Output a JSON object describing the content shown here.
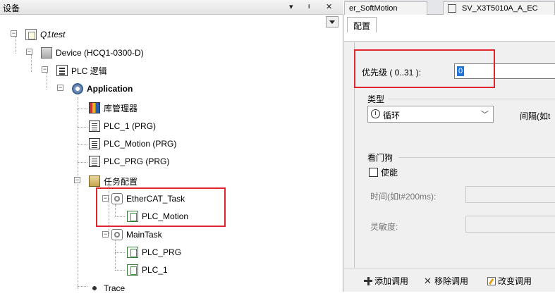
{
  "left_panel": {
    "title": "设备",
    "pin_glyph": "▾",
    "pin2_glyph": "ᵻ",
    "close_glyph": "✕"
  },
  "tree": {
    "project": "Q1test",
    "device": "Device (HCQ1-0300-D)",
    "plc_logic": "PLC 逻辑",
    "application": "Application",
    "library_manager": "库管理器",
    "pou_plc1": "PLC_1 (PRG)",
    "pou_plc_motion": "PLC_Motion (PRG)",
    "pou_plc_prg": "PLC_PRG (PRG)",
    "task_config": "任务配置",
    "ethercat_task": "EtherCAT_Task",
    "ethercat_call": "PLC_Motion",
    "main_task": "MainTask",
    "main_call1": "PLC_PRG",
    "main_call2": "PLC_1",
    "trace": "Trace"
  },
  "right_panel": {
    "doc_tab1": "er_SoftMotion",
    "doc_tab2": "SV_X3T5010A_A_EC",
    "config_tab": "配置",
    "priority_label": "优先级 ( 0..31 ):",
    "priority_value": "0",
    "type_group": "类型",
    "type_value": "循环",
    "interval_label": "间隔(如t",
    "watchdog_group": "看门狗",
    "enable_label": "使能",
    "time_label": "时间(如t#200ms):",
    "sensitivity_label": "灵敏度:",
    "add_call": "添加调用",
    "remove_call": "移除调用",
    "change_call": "改变调用"
  },
  "colors": {
    "highlight_box": "#e0262b",
    "selection_caret": "#1e74d6"
  }
}
